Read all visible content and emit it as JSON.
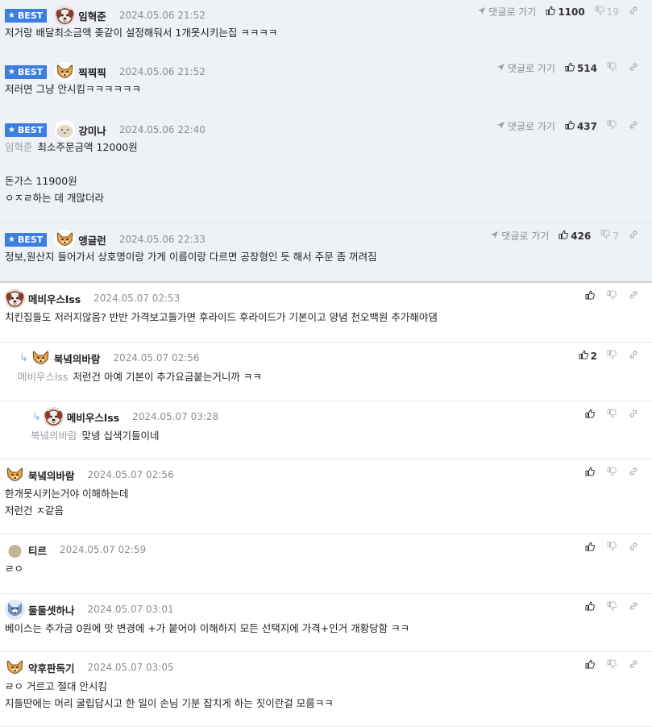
{
  "labels": {
    "best": "BEST",
    "goto_reply": "댓글로 가기"
  },
  "colors": {
    "best_badge": "#3d7fe0",
    "best_bg": "#eef1f5",
    "mention": "#9aa0a6"
  },
  "comments": [
    {
      "best": true,
      "avatar": "puppy-avatar",
      "nick": "임혁준",
      "date": "2024.05.06 21:52",
      "goto": true,
      "likes": "1100",
      "dislikes": "19",
      "mention": "",
      "lines": [
        "저거랑 배달최소금액 좆같이 설정해둬서 1개못시키는집 ㅋㅋㅋㅋ"
      ]
    },
    {
      "best": true,
      "avatar": "shiba-avatar",
      "nick": "찍찍찍",
      "date": "2024.05.06 21:52",
      "goto": true,
      "likes": "514",
      "dislikes": "",
      "mention": "",
      "lines": [
        "저러면 그냥 안시킴ㅋㅋㅋㅋㅋㅋ"
      ]
    },
    {
      "best": true,
      "avatar": "maltese-avatar",
      "nick": "강미나",
      "date": "2024.05.06 22:40",
      "goto": true,
      "likes": "437",
      "dislikes": "",
      "mention": "임혁준",
      "lines": [
        "최소주문금액 12000원",
        "",
        "돈가스 11900원",
        "ㅇㅈㄹ하는 데 개많더라"
      ]
    },
    {
      "best": true,
      "avatar": "shiba-avatar",
      "nick": "앵글런",
      "date": "2024.05.06 22:33",
      "goto": true,
      "likes": "426",
      "dislikes": "7",
      "mention": "",
      "lines": [
        "정보,원산지 들어가서 상호명이랑 가게 이름이랑 다르면 공장형인 듯 해서 주문 좀 꺼려짐"
      ]
    },
    {
      "best": false,
      "avatar": "puppy-avatar",
      "nick": "메비우스lss",
      "date": "2024.05.07 02:53",
      "goto": false,
      "likes": "",
      "dislikes": "",
      "mention": "",
      "lines": [
        "치킨집들도 저러지않음? 반반 가격보고들가면 후라이드 후라이드가 기본이고 양념 천오백원 추가해야댐"
      ]
    },
    {
      "best": false,
      "reply": 1,
      "avatar": "shiba-avatar",
      "nick": "북녘의바람",
      "date": "2024.05.07 02:56",
      "goto": false,
      "likes": "2",
      "dislikes": "",
      "mention": "메비우스lss",
      "lines": [
        "저런건 아예 기본이 추가요금붙는거니까 ㅋㅋ"
      ]
    },
    {
      "best": false,
      "reply": 2,
      "avatar": "puppy-avatar",
      "nick": "메비우스lss",
      "date": "2024.05.07 03:28",
      "goto": false,
      "likes": "",
      "dislikes": "",
      "mention": "북녘의바람",
      "lines": [
        "맞넹 십색기들이네"
      ]
    },
    {
      "best": false,
      "avatar": "shiba-avatar",
      "nick": "북녘의바람",
      "date": "2024.05.07 02:56",
      "goto": false,
      "likes": "",
      "dislikes": "",
      "mention": "",
      "lines": [
        "한개못시키는거야 이해하는데",
        "저런건 ㅈ같음"
      ]
    },
    {
      "best": false,
      "avatar": "blob-avatar",
      "nick": "티르",
      "date": "2024.05.07 02:59",
      "goto": false,
      "likes": "",
      "dislikes": "",
      "mention": "",
      "lines": [
        "ㄹㅇ"
      ]
    },
    {
      "best": false,
      "avatar": "husky-avatar",
      "nick": "둘둘셋하나",
      "date": "2024.05.07 03:01",
      "goto": false,
      "likes": "",
      "dislikes": "",
      "mention": "",
      "lines": [
        "베이스는 추가금 0원에 맛 변경에 +가 붙어야 이해하지 모든 선택지에 가격+인거 개황당함 ㅋㅋ"
      ]
    },
    {
      "best": false,
      "avatar": "shiba-avatar",
      "nick": "약후판독기",
      "date": "2024.05.07 03:05",
      "goto": false,
      "likes": "",
      "dislikes": "",
      "mention": "",
      "lines": [
        "ㄹㅇ 거르고 절대 안시킴",
        "지들딴에는 머리 굴립답시고 한 일이 손님 기분 잡치게 하는 짓이란걸 모름ㅋㅋ"
      ]
    }
  ]
}
